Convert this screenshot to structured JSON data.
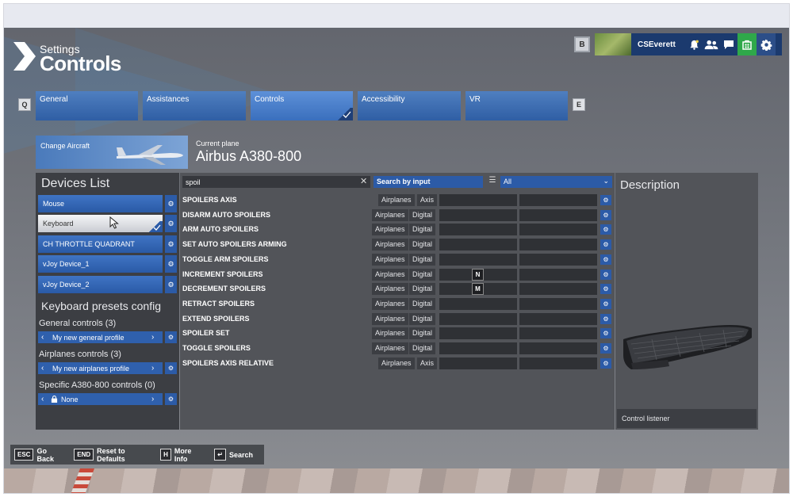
{
  "header": {
    "section": "Settings",
    "title": "Controls"
  },
  "topbar": {
    "b_key": "B",
    "username": "CSEverett",
    "icons": [
      "bell-icon",
      "friends-icon",
      "chat-icon",
      "store-icon",
      "gear-icon"
    ],
    "brand_color": "#1b3a6e",
    "store_color": "#2fa84a"
  },
  "tabs": {
    "prev_key": "Q",
    "next_key": "E",
    "items": [
      {
        "label": "General"
      },
      {
        "label": "Assistances"
      },
      {
        "label": "Controls",
        "active": true
      },
      {
        "label": "Accessibility"
      },
      {
        "label": "VR"
      }
    ]
  },
  "aircraft": {
    "change_label": "Change Aircraft",
    "current_label": "Current plane",
    "current_plane": "Airbus A380-800"
  },
  "devices": {
    "title": "Devices List",
    "items": [
      {
        "label": "Mouse"
      },
      {
        "label": "Keyboard",
        "selected": true
      },
      {
        "label": "CH THROTTLE QUADRANT"
      },
      {
        "label": "vJoy Device_1"
      },
      {
        "label": "vJoy Device_2"
      }
    ]
  },
  "presets": {
    "title": "Keyboard presets config",
    "groups": [
      {
        "heading": "General controls (3)",
        "profile": "My new general profile"
      },
      {
        "heading": "Airplanes controls (3)",
        "profile": "My new airplanes profile"
      },
      {
        "heading": "Specific A380-800 controls (0)",
        "profile": "None"
      }
    ]
  },
  "search": {
    "value": "spoil",
    "mode": "Search by input",
    "filter": "All"
  },
  "bindings": [
    {
      "name": "SPOILERS AXIS",
      "category": "Airplanes",
      "type": "Axis",
      "key1": "",
      "key2": ""
    },
    {
      "name": "DISARM AUTO SPOILERS",
      "category": "Airplanes",
      "type": "Digital",
      "key1": "",
      "key2": ""
    },
    {
      "name": "ARM AUTO SPOILERS",
      "category": "Airplanes",
      "type": "Digital",
      "key1": "",
      "key2": ""
    },
    {
      "name": "SET AUTO SPOILERS ARMING",
      "category": "Airplanes",
      "type": "Digital",
      "key1": "",
      "key2": ""
    },
    {
      "name": "TOGGLE ARM SPOILERS",
      "category": "Airplanes",
      "type": "Digital",
      "key1": "",
      "key2": ""
    },
    {
      "name": "INCREMENT SPOILERS",
      "category": "Airplanes",
      "type": "Digital",
      "key1": "N",
      "key2": ""
    },
    {
      "name": "DECREMENT SPOILERS",
      "category": "Airplanes",
      "type": "Digital",
      "key1": "M",
      "key2": ""
    },
    {
      "name": "RETRACT SPOILERS",
      "category": "Airplanes",
      "type": "Digital",
      "key1": "",
      "key2": ""
    },
    {
      "name": "EXTEND SPOILERS",
      "category": "Airplanes",
      "type": "Digital",
      "key1": "",
      "key2": ""
    },
    {
      "name": "SPOILER SET",
      "category": "Airplanes",
      "type": "Digital",
      "key1": "",
      "key2": ""
    },
    {
      "name": "TOGGLE SPOILERS",
      "category": "Airplanes",
      "type": "Digital",
      "key1": "",
      "key2": ""
    },
    {
      "name": "SPOILERS AXIS RELATIVE",
      "category": "Airplanes",
      "type": "Axis",
      "key1": "",
      "key2": ""
    }
  ],
  "description": {
    "title": "Description",
    "listener": "Control listener"
  },
  "footer": [
    {
      "key": "ESC",
      "label": "Go Back"
    },
    {
      "key": "END",
      "label": "Reset to Defaults"
    },
    {
      "key": "H",
      "label": "More Info"
    },
    {
      "key": "↵",
      "label": "Search"
    }
  ]
}
